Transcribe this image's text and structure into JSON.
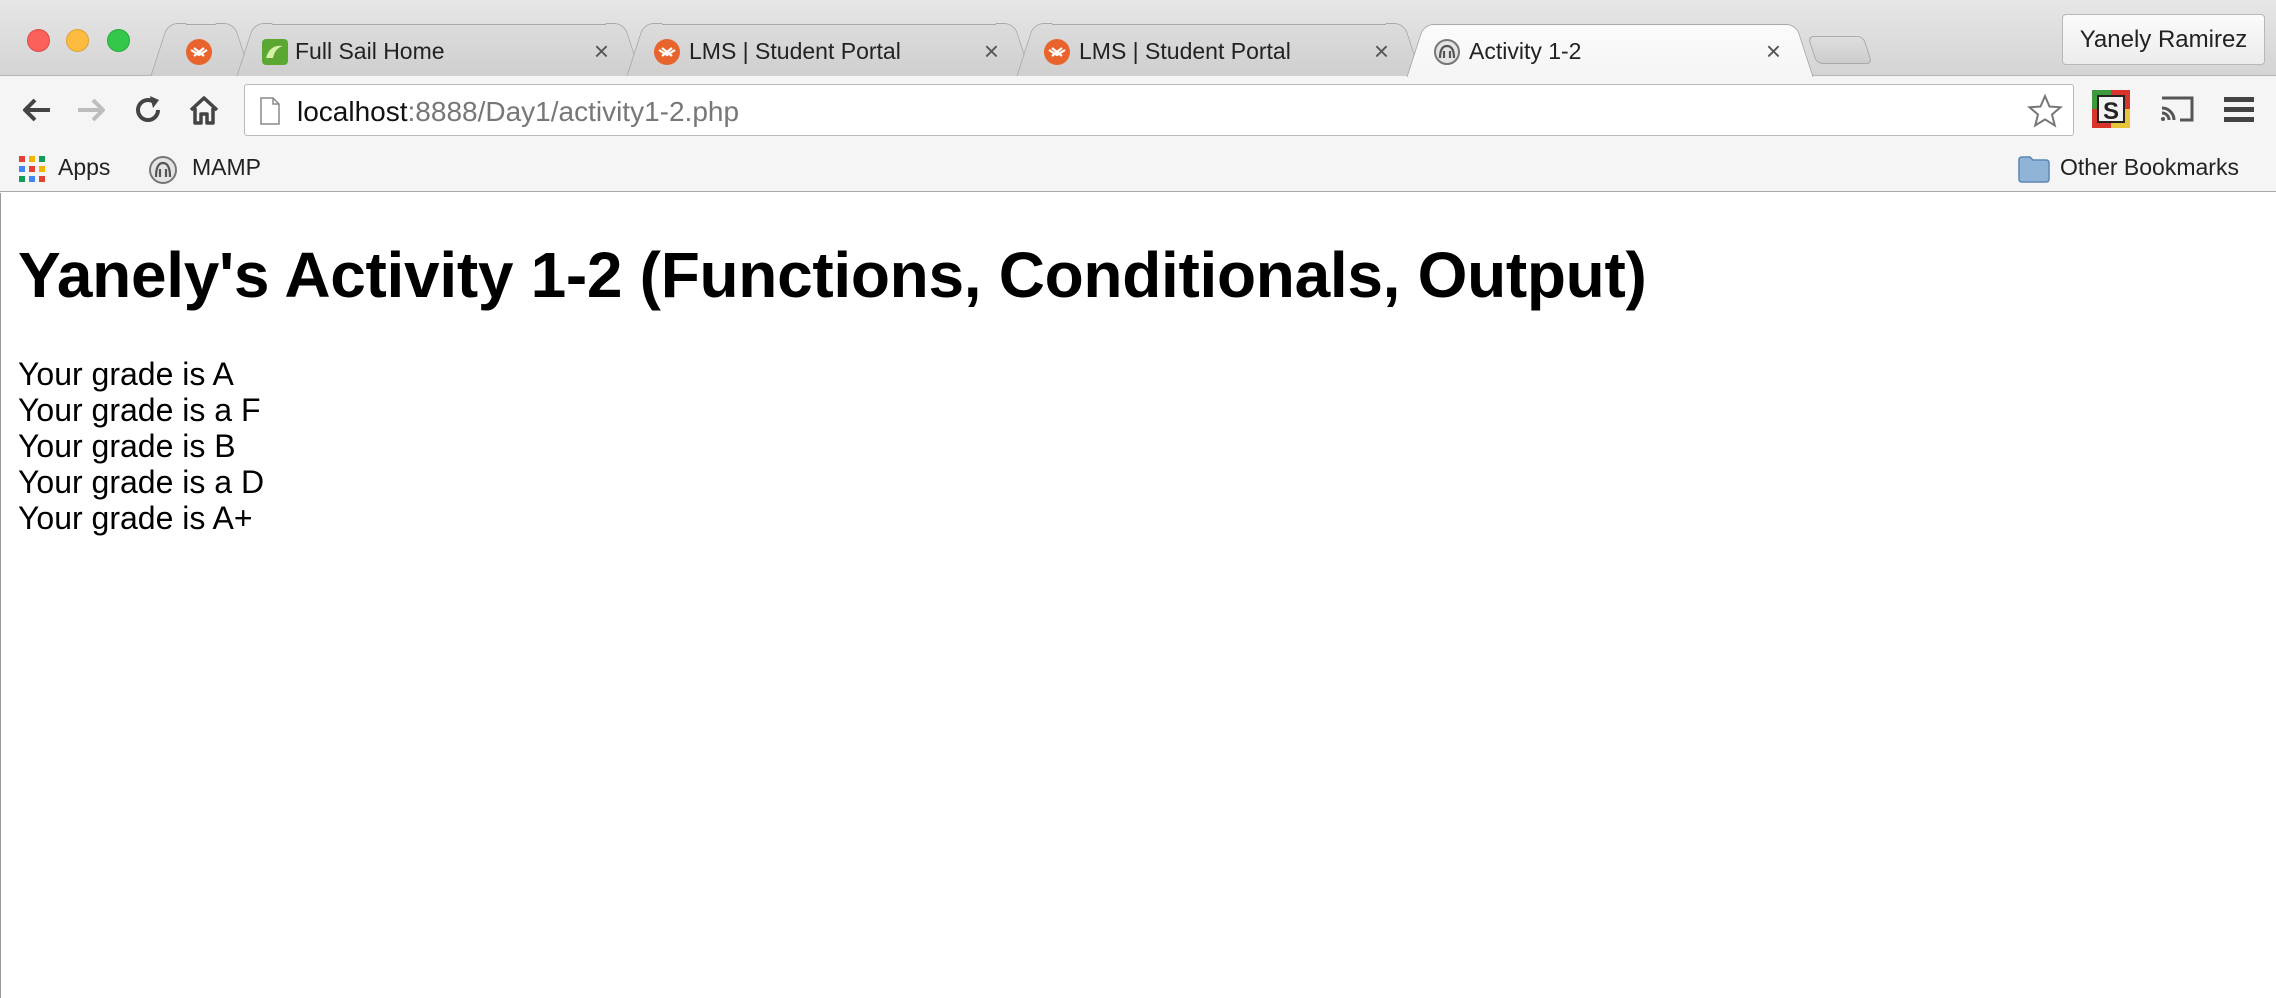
{
  "tabs": [
    {
      "title": "",
      "icon": "lms-icon"
    },
    {
      "title": "Full Sail Home",
      "icon": "fullsail-icon"
    },
    {
      "title": "LMS | Student Portal",
      "icon": "lms-icon"
    },
    {
      "title": "LMS | Student Portal",
      "icon": "lms-icon"
    },
    {
      "title": "Activity 1-2",
      "icon": "mamp-icon",
      "active": true
    }
  ],
  "tab_close_glyph": "×",
  "profile": {
    "name": "Yanely Ramirez"
  },
  "address": {
    "host": "localhost",
    "path": ":8888/Day1/activity1-2.php"
  },
  "bookmarks": {
    "apps": "Apps",
    "mamp": "MAMP",
    "other": "Other Bookmarks"
  },
  "page": {
    "heading": "Yanely's Activity 1-2 (Functions, Conditionals, Output)",
    "lines": [
      "Your grade is A",
      "Your grade is a F",
      "Your grade is B",
      "Your grade is a D",
      "Your grade is A+"
    ]
  },
  "colors": {
    "lms_orange": "#e8642c",
    "fullsail_green": "#5aa832",
    "close_red": "#fc605b",
    "minimize_yellow": "#fdbc40",
    "zoom_green": "#34c84a"
  }
}
